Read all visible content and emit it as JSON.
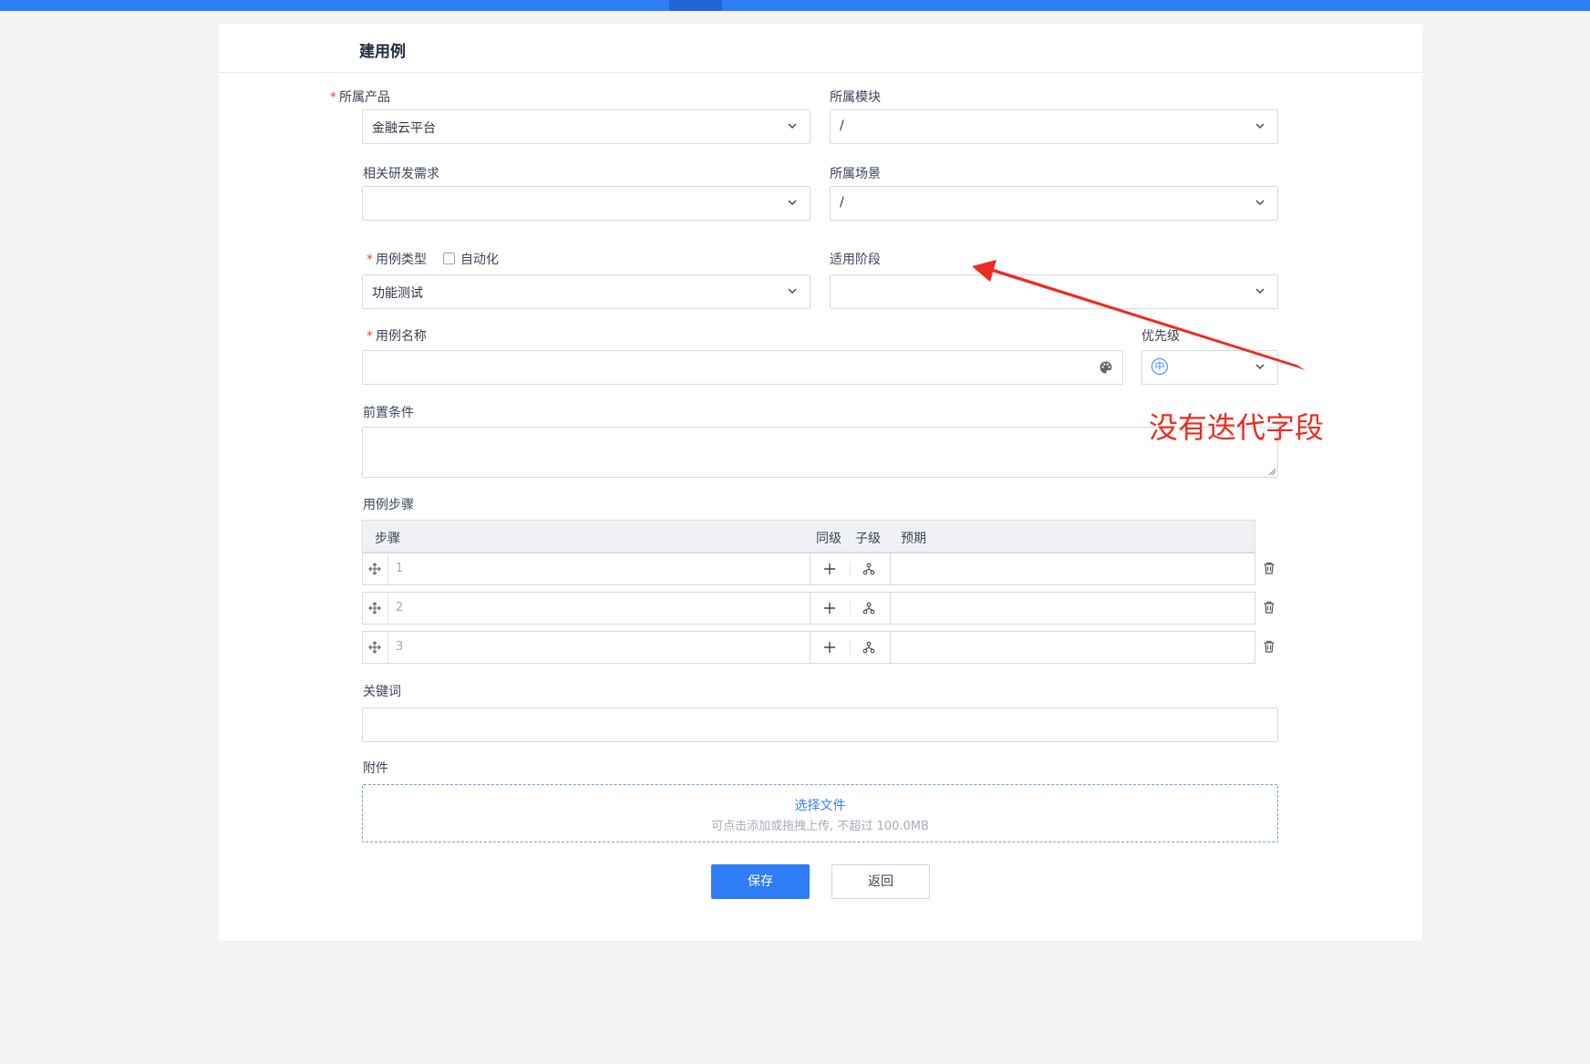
{
  "page": {
    "title": "建用例",
    "form": {
      "product": {
        "label": "所属产品",
        "value": "金融云平台"
      },
      "module": {
        "label": "所属模块",
        "value": "/"
      },
      "requirement": {
        "label": "相关研发需求",
        "value": ""
      },
      "scenario": {
        "label": "所属场景",
        "value": "/"
      },
      "case_type": {
        "label": "用例类型",
        "automation_label": "自动化",
        "value": "功能测试"
      },
      "stage": {
        "label": "适用阶段",
        "value": ""
      },
      "case_name": {
        "label": "用例名称",
        "value": ""
      },
      "priority": {
        "label": "优先级",
        "value": "中"
      },
      "precondition": {
        "label": "前置条件",
        "value": ""
      },
      "steps": {
        "label": "用例步骤",
        "headers": {
          "step": "步骤",
          "sibling": "同级",
          "child": "子级",
          "expected": "预期"
        },
        "rows": [
          {
            "num": "1"
          },
          {
            "num": "2"
          },
          {
            "num": "3"
          }
        ]
      },
      "keywords": {
        "label": "关键词",
        "value": ""
      },
      "attachment": {
        "label": "附件",
        "pick_label": "选择文件",
        "hint": "可点击添加或拖拽上传, 不超过 100.0MB"
      }
    },
    "actions": {
      "save": "保存",
      "back": "返回"
    }
  },
  "annotation": {
    "text": "没有迭代字段",
    "color": "#ee2b22"
  },
  "colors": {
    "primary": "#2e7cf6",
    "required": "#f0413b"
  },
  "icons": [
    "chevron-down-icon",
    "palette-icon",
    "drag-move-icon",
    "plus-icon",
    "tree-child-icon",
    "trash-icon"
  ]
}
